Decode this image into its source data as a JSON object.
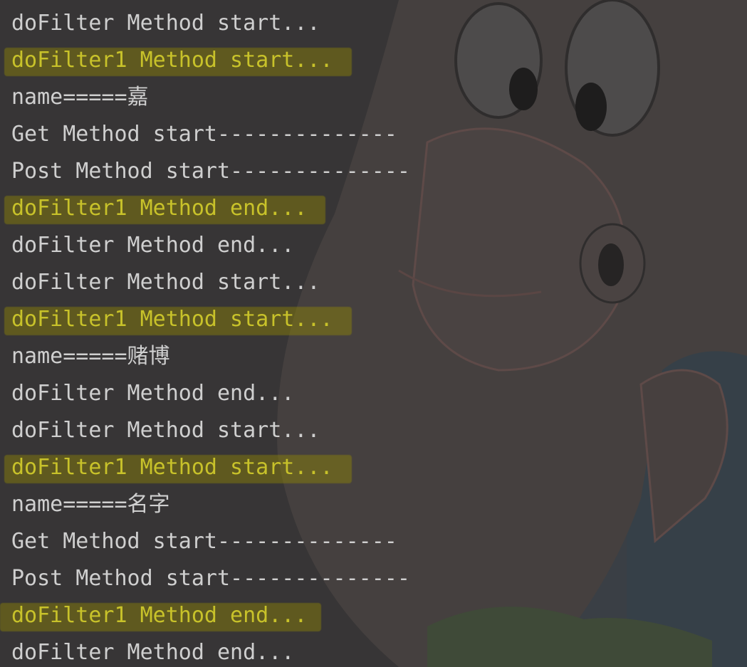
{
  "console": {
    "background_color": "#373536",
    "text_color": "#cfcfcf",
    "highlight_text_color": "#c8c22a",
    "highlight_marker_color": "#968c00",
    "background_art": "patrick-star-icon",
    "lines": [
      {
        "text": "doFilter Method start...",
        "highlighted": false
      },
      {
        "text": "doFilter1 Method start...",
        "highlighted": true
      },
      {
        "text": "name=====嘉",
        "highlighted": false
      },
      {
        "text": "Get Method start--------------",
        "highlighted": false
      },
      {
        "text": "Post Method start--------------",
        "highlighted": false
      },
      {
        "text": "doFilter1 Method end...",
        "highlighted": true
      },
      {
        "text": "doFilter Method end...",
        "highlighted": false
      },
      {
        "text": "doFilter Method start...",
        "highlighted": false
      },
      {
        "text": "doFilter1 Method start...",
        "highlighted": true
      },
      {
        "text": "name=====赌博",
        "highlighted": false
      },
      {
        "text": "doFilter Method end...",
        "highlighted": false
      },
      {
        "text": "doFilter Method start...",
        "highlighted": false
      },
      {
        "text": "doFilter1 Method start...",
        "highlighted": true
      },
      {
        "text": "name=====名字",
        "highlighted": false
      },
      {
        "text": "Get Method start--------------",
        "highlighted": false
      },
      {
        "text": "Post Method start--------------",
        "highlighted": false
      },
      {
        "text": "doFilter1 Method end...",
        "highlighted": true
      },
      {
        "text": "doFilter Method end...",
        "highlighted": false
      }
    ]
  }
}
